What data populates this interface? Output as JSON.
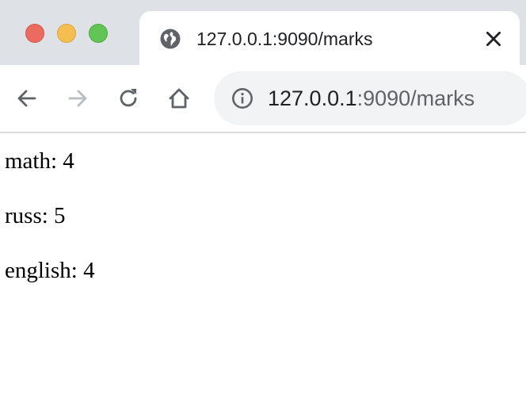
{
  "tab": {
    "title": "127.0.0.1:9090/marks",
    "favicon": "globe-icon",
    "close_icon": "close-icon"
  },
  "window_controls": {
    "close_color": "#ed6a5e",
    "minimize_color": "#f5bf4f",
    "maximize_color": "#61c554"
  },
  "toolbar": {
    "back_icon": "arrow-left-icon",
    "forward_icon": "arrow-right-icon",
    "reload_icon": "reload-icon",
    "home_icon": "home-icon"
  },
  "omnibox": {
    "security_icon": "info-icon",
    "host": "127.0.0.1",
    "rest": ":9090/marks"
  },
  "page": {
    "marks": [
      {
        "subject": "math",
        "grade": "4",
        "text": "math: 4"
      },
      {
        "subject": "russ",
        "grade": "5",
        "text": "russ: 5"
      },
      {
        "subject": "english",
        "grade": "4",
        "text": "english: 4"
      }
    ]
  }
}
